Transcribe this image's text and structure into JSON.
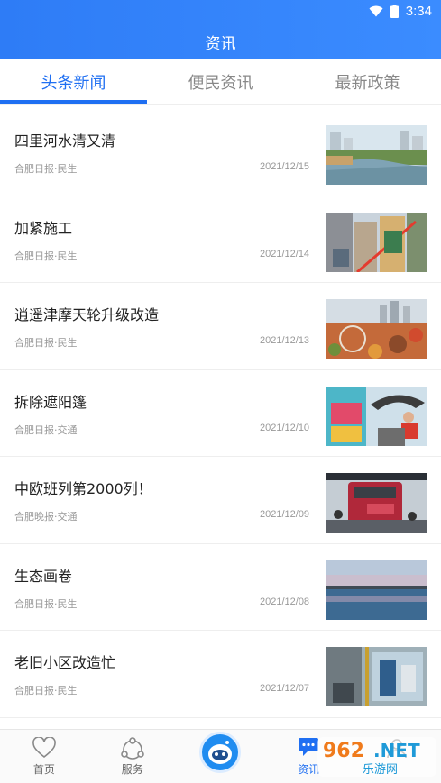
{
  "status": {
    "time": "3:34"
  },
  "header": {
    "title": "资讯"
  },
  "tabs": [
    {
      "label": "头条新闻",
      "active": true
    },
    {
      "label": "便民资讯",
      "active": false
    },
    {
      "label": "最新政策",
      "active": false
    }
  ],
  "news": [
    {
      "title": "四里河水清又清",
      "source": "合肥日报·民生",
      "date": "2021/12/15",
      "thumb": "river"
    },
    {
      "title": "加紧施工",
      "source": "合肥日报·民生",
      "date": "2021/12/14",
      "thumb": "construction"
    },
    {
      "title": "逍遥津摩天轮升级改造",
      "source": "合肥日报·民生",
      "date": "2021/12/13",
      "thumb": "ferris-wheel"
    },
    {
      "title": "拆除遮阳篷",
      "source": "合肥日报·交通",
      "date": "2021/12/10",
      "thumb": "awning-removal"
    },
    {
      "title": "中欧班列第2000列！",
      "source": "合肥晚报·交通",
      "date": "2021/12/09",
      "thumb": "train"
    },
    {
      "title": "生态画卷",
      "source": "合肥日报·民生",
      "date": "2021/12/08",
      "thumb": "lake"
    },
    {
      "title": "老旧小区改造忙",
      "source": "合肥日报·民生",
      "date": "2021/12/07",
      "thumb": "renovation"
    }
  ],
  "nav": [
    {
      "label": "首页",
      "icon": "heart-icon"
    },
    {
      "label": "服务",
      "icon": "service-icon"
    },
    {
      "label": "",
      "icon": "robot-icon"
    },
    {
      "label": "资讯",
      "icon": "chat-icon"
    },
    {
      "label": "",
      "icon": "profile-icon"
    }
  ],
  "watermark": {
    "text": "962.NET",
    "subtext": "乐游网"
  },
  "colors": {
    "primary": "#1f6ff2",
    "header": "#3b8cff"
  }
}
